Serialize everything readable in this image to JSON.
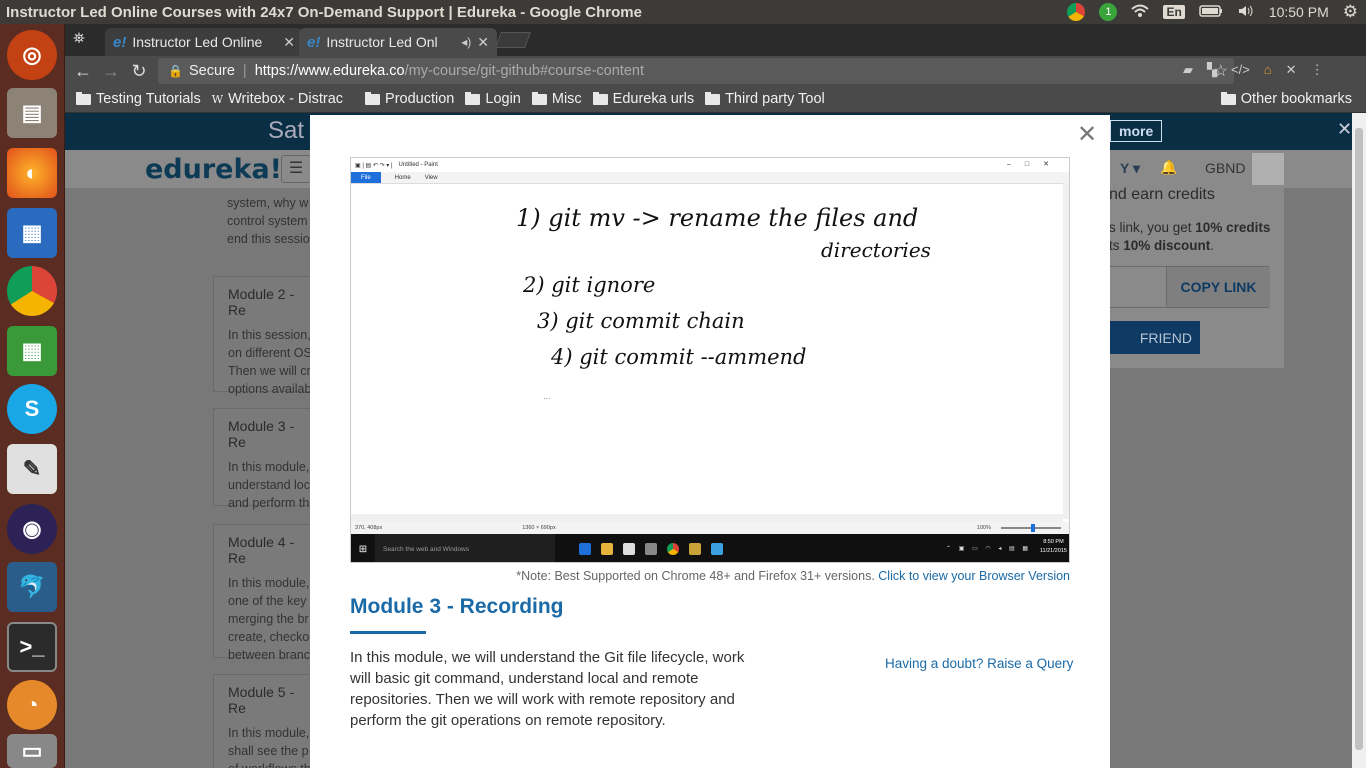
{
  "window_title": "Instructor Led Online Courses with 24x7 On-Demand Support | Edureka - Google Chrome",
  "tray": {
    "badge": "1",
    "lang": "En",
    "time": "10:50 PM"
  },
  "tabs": [
    {
      "favicon": "e!",
      "label": "Instructor Led Online"
    },
    {
      "favicon": "e!",
      "label": "Instructor Led Onl"
    }
  ],
  "omnibox": {
    "secure": "Secure",
    "host": "https://www.edureka.co",
    "path": "/my-course/git-github#course-content"
  },
  "bookmarks": [
    "Testing Tutorials",
    "Writebox - Distrac",
    "Production",
    "Login",
    "Misc",
    "Edureka urls",
    "Third party Tool"
  ],
  "other_bookmarks": "Other bookmarks",
  "page": {
    "banner_text": "Sat",
    "banner_more": "more",
    "logo": "edureka!",
    "user": "GBND",
    "earn_credits": "nd earn credits",
    "credits_line1_a": "s link, you get ",
    "credits_line1_b": "10% credits",
    "credits_line2_a": "ts ",
    "credits_line2_b": "10% discount",
    "credits_line2_c": ".",
    "copy_link": "COPY LINK",
    "friend": "FRIEND",
    "module_cards": [
      {
        "title": "",
        "lines": [
          "system, why w",
          "control system",
          "end this sessio"
        ]
      },
      {
        "title": "Module 2 - Re",
        "lines": [
          "In this session,",
          "on different OS",
          "Then we will cr",
          "options availab"
        ]
      },
      {
        "title": "Module 3 - Re",
        "lines": [
          "In this module,",
          "understand loc",
          "and perform th"
        ]
      },
      {
        "title": "Module 4 - Re",
        "lines": [
          "In this module,",
          "one of the key",
          "merging the br",
          "create, checkou",
          "between branc"
        ]
      },
      {
        "title": "Module 5 - Re",
        "lines": [
          "In this module,",
          "shall see the p",
          "of workflows th"
        ]
      }
    ]
  },
  "modal": {
    "paint": {
      "title": "Untitled - Paint",
      "ribbon": [
        "File",
        "Home",
        "View"
      ],
      "status_pos": "370, 408px",
      "status_size": "1360 × 690px",
      "zoom": "100%",
      "taskbar_search": "Search the web and Windows",
      "taskbar_time": "8:50 PM",
      "taskbar_date": "11/21/2015",
      "handwriting": [
        "1) git mv -> rename the files and",
        "directories",
        "2) git ignore",
        "3) git commit chain",
        "4) git commit --ammend"
      ]
    },
    "note_text": "*Note: Best Supported on Chrome 48+ and Firefox 31+ versions. ",
    "note_link": "Click to view your Browser Version",
    "title": "Module 3 - Recording",
    "description": "In this module, we will understand the Git file lifecycle, work will basic git command, understand local and remote repositories. Then we will work with remote repository and perform the git operations on remote repository.",
    "doubt_link": "Having a doubt? Raise a Query"
  }
}
